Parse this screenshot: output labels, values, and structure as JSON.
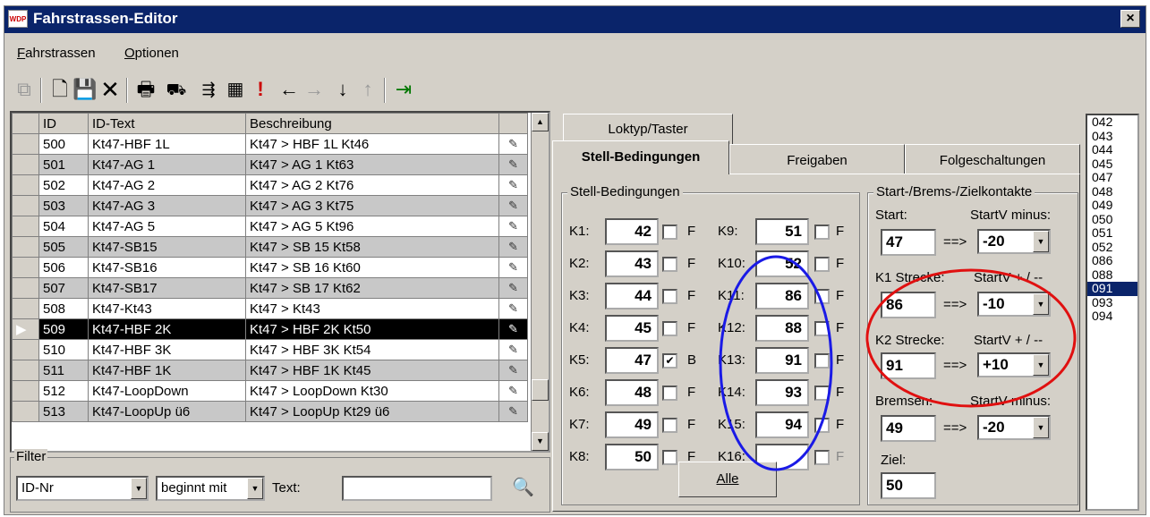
{
  "window": {
    "title": "Fahrstrassen-Editor",
    "icon_text": "WDP",
    "close_label": "×"
  },
  "menu": [
    "Fahrstrassen",
    "Optionen"
  ],
  "toolbar": [
    "copy-icon",
    "new-icon",
    "save-icon",
    "delete-icon",
    "print-icon",
    "locomotive-icon",
    "route-icon",
    "signal-icon",
    "warning-icon",
    "arrow-left-icon",
    "arrow-right-icon",
    "arrow-down-icon",
    "arrow-up-icon",
    "exit-icon"
  ],
  "table": {
    "headers": [
      "ID",
      "ID-Text",
      "Beschreibung"
    ],
    "rows": [
      [
        "500",
        "Kt47-HBF 1L",
        "Kt47 > HBF 1L Kt46"
      ],
      [
        "501",
        "Kt47-AG 1",
        "Kt47 > AG 1 Kt63"
      ],
      [
        "502",
        "Kt47-AG 2",
        "Kt47 > AG 2 Kt76"
      ],
      [
        "503",
        "Kt47-AG 3",
        "Kt47 > AG 3 Kt75"
      ],
      [
        "504",
        "Kt47-AG 5",
        "Kt47 > AG 5 Kt96"
      ],
      [
        "505",
        "Kt47-SB15",
        "Kt47 > SB 15 Kt58"
      ],
      [
        "506",
        "Kt47-SB16",
        "Kt47 > SB 16 Kt60"
      ],
      [
        "507",
        "Kt47-SB17",
        "Kt47 > SB 17 Kt62"
      ],
      [
        "508",
        "Kt47-Kt43",
        "Kt47 > Kt43"
      ],
      [
        "509",
        "Kt47-HBF 2K",
        "Kt47 > HBF 2K Kt50"
      ],
      [
        "510",
        "Kt47-HBF 3K",
        "Kt47 > HBF 3K Kt54"
      ],
      [
        "511",
        "Kt47-HBF 1K",
        "Kt47 > HBF 1K Kt45"
      ],
      [
        "512",
        "Kt47-LoopDown",
        "Kt47 > LoopDown Kt30"
      ],
      [
        "513",
        "Kt47-LoopUp ü6",
        "Kt47 > LoopUp Kt29 ü6"
      ]
    ]
  },
  "filter": {
    "legend": "Filter",
    "field": "ID-Nr",
    "mode": "beginnt mit",
    "text_label": "Text:",
    "text_value": ""
  },
  "tabs": {
    "loktyp": "Loktyp/Taster",
    "stell": "Stell-Bedingungen",
    "freigaben": "Freigaben",
    "folge": "Folgeschaltungen"
  },
  "stell": {
    "legend": "Stell-Bedingungen",
    "left": [
      {
        "label": "K1:",
        "value": "42",
        "checked": false,
        "flag": "F"
      },
      {
        "label": "K2:",
        "value": "43",
        "checked": false,
        "flag": "F"
      },
      {
        "label": "K3:",
        "value": "44",
        "checked": false,
        "flag": "F"
      },
      {
        "label": "K4:",
        "value": "45",
        "checked": false,
        "flag": "F"
      },
      {
        "label": "K5:",
        "value": "47",
        "checked": true,
        "flag": "B"
      },
      {
        "label": "K6:",
        "value": "48",
        "checked": false,
        "flag": "F"
      },
      {
        "label": "K7:",
        "value": "49",
        "checked": false,
        "flag": "F"
      },
      {
        "label": "K8:",
        "value": "50",
        "checked": false,
        "flag": "F"
      }
    ],
    "right": [
      {
        "label": "K9:",
        "value": "51",
        "checked": false,
        "flag": "F"
      },
      {
        "label": "K10:",
        "value": "52",
        "checked": false,
        "flag": "F"
      },
      {
        "label": "K11:",
        "value": "86",
        "checked": false,
        "flag": "F"
      },
      {
        "label": "K12:",
        "value": "88",
        "checked": false,
        "flag": "F"
      },
      {
        "label": "K13:",
        "value": "91",
        "checked": false,
        "flag": "F"
      },
      {
        "label": "K14:",
        "value": "93",
        "checked": false,
        "flag": "F"
      },
      {
        "label": "K15:",
        "value": "94",
        "checked": false,
        "flag": "F"
      },
      {
        "label": "K16:",
        "value": "",
        "checked": false,
        "flag": "F"
      }
    ],
    "alle": "Alle"
  },
  "kontakte": {
    "legend": "Start-/Brems-/Zielkontakte",
    "arrow": "==>",
    "start": {
      "label": "Start:",
      "vlabel": "StartV minus:",
      "value": "47",
      "v": "-20"
    },
    "k1": {
      "label": "K1 Strecke:",
      "vlabel": "StartV + / --",
      "value": "86",
      "v": "-10"
    },
    "k2": {
      "label": "K2 Strecke:",
      "vlabel": "StartV + / --",
      "value": "91",
      "v": "+10"
    },
    "brems": {
      "label": "Bremsen:",
      "vlabel": "StartV minus:",
      "value": "49",
      "v": "-20"
    },
    "ziel": {
      "label": "Ziel:",
      "value": "50"
    }
  },
  "idlist": {
    "items": [
      "042",
      "043",
      "044",
      "045",
      "047",
      "048",
      "049",
      "050",
      "051",
      "052",
      "086",
      "088",
      "091",
      "093",
      "094"
    ],
    "selected": "091"
  },
  "colors": {
    "title": "#0a246a",
    "selection": "#0a246a",
    "annotation_blue": "#1a1ae6",
    "annotation_red": "#e01010"
  }
}
